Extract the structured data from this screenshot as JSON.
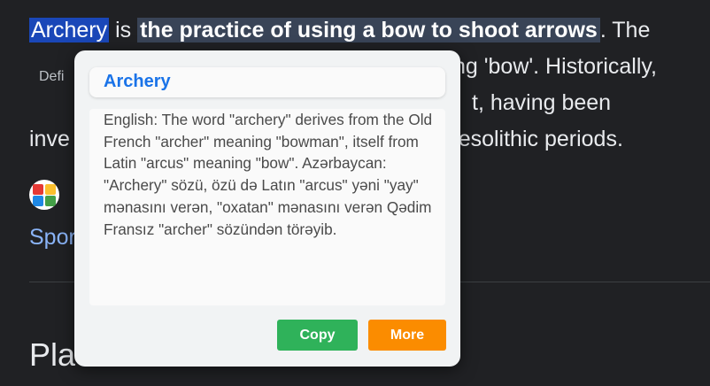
{
  "page": {
    "paragraph": {
      "selected_word": "Archery",
      "connector": " is ",
      "definition_phrase": "the practice of using a bow to shoot arrows",
      "after_phrase": ". The",
      "line2_end": "ng 'bow'. Historically,",
      "line3_end": "t, having been",
      "line4_start": "inve",
      "line4_end": "Mesolithic periods."
    },
    "def_chip_label": "Defi",
    "sports_link": "Spor",
    "places_heading": "Places"
  },
  "popup": {
    "title": "Archery",
    "definition": "English: The word \"archery\" derives from the Old French \"archer\" meaning \"bowman\", itself from Latin \"arcus\" meaning \"bow\". Azərbaycan: \"Archery\" sözü, özü də Latın \"arcus\" yəni \"yay\" mənasını verən, \"oxatan\" mənasını verən Qədim Fransız \"archer\" sözündən törəyib.",
    "copy_label": "Copy",
    "more_label": "More"
  },
  "colors": {
    "background": "#202124",
    "selection": "#1a47b8",
    "definition_highlight": "#394457",
    "title_blue": "#1a73e8",
    "copy_green": "#2fb25a",
    "more_orange": "#fb8c00",
    "link_blue": "#8ab4f8"
  }
}
